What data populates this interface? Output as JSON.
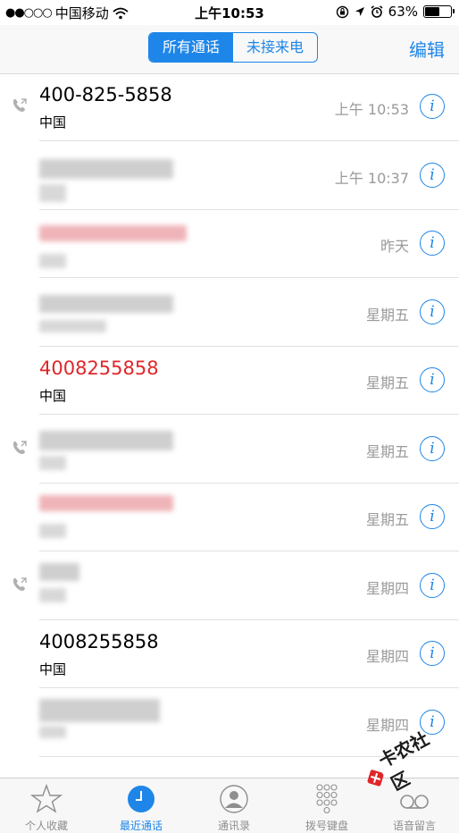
{
  "status": {
    "signal": "●●○○○",
    "carrier": "中国移动",
    "time": "上午10:53",
    "battery": "63%",
    "battery_level": 0.63
  },
  "nav": {
    "tab_all": "所有通话",
    "tab_missed": "未接来电",
    "edit": "编辑"
  },
  "calls": [
    {
      "name": "400-825-5858",
      "sub": "中国",
      "time": "上午 10:53",
      "outgoing": true,
      "red": false
    },
    {
      "name": "",
      "sub": "",
      "time": "上午 10:37",
      "outgoing": false,
      "red": false
    },
    {
      "name": "",
      "sub": "",
      "time": "昨天",
      "outgoing": false,
      "red": false
    },
    {
      "name": "",
      "sub": "",
      "time": "星期五",
      "outgoing": false,
      "red": false
    },
    {
      "name": "4008255858",
      "sub": "中国",
      "time": "星期五",
      "outgoing": false,
      "red": true
    },
    {
      "name": "",
      "sub": "",
      "time": "星期五",
      "outgoing": true,
      "red": false
    },
    {
      "name": "",
      "sub": "",
      "time": "星期五",
      "outgoing": false,
      "red": false
    },
    {
      "name": "",
      "sub": "",
      "time": "星期四",
      "outgoing": true,
      "red": false
    },
    {
      "name": "4008255858",
      "sub": "中国",
      "time": "星期四",
      "outgoing": false,
      "red": false
    },
    {
      "name": "",
      "sub": "",
      "time": "星期四",
      "outgoing": false,
      "red": false
    }
  ],
  "tabs": {
    "favorites": "个人收藏",
    "recents": "最近通话",
    "contacts": "通讯录",
    "keypad": "拨号键盘",
    "voicemail": "语音留言"
  },
  "watermark": "卡农社区",
  "colors": {
    "accent": "#1e86e8",
    "missed": "#e0262a",
    "secondary_text": "#9a9a9a"
  }
}
